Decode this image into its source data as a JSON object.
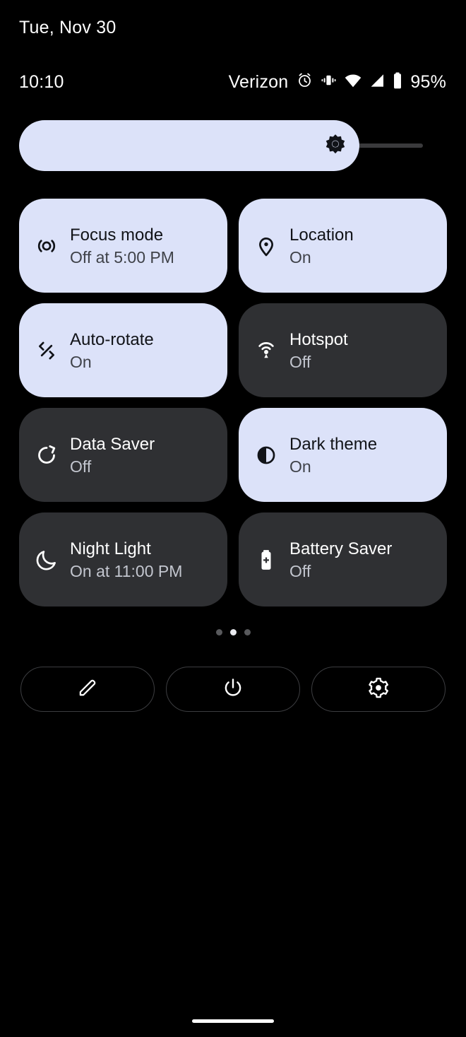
{
  "statusbar": {
    "date": "Tue, Nov 30",
    "clock": "10:10",
    "carrier": "Verizon",
    "battery_percent": "95%",
    "icons": [
      "alarm-icon",
      "vibrate-icon",
      "wifi-icon",
      "cellular-signal-icon",
      "battery-icon"
    ]
  },
  "brightness": {
    "icon": "brightness-icon",
    "level_percent": 84,
    "fill_color": "#dce2f9",
    "track_color": "#3a3a3c"
  },
  "colors": {
    "background": "#000000",
    "tile_active_bg": "#dce2f9",
    "tile_inactive_bg": "#2f3033",
    "tile_active_title": "#111318",
    "tile_active_subtitle": "#3f4249",
    "tile_inactive_title": "#ffffff",
    "tile_inactive_subtitle": "#c3c6cf"
  },
  "tiles": [
    {
      "title": "Focus mode",
      "subtitle": "Off at 5:00 PM",
      "state": "active",
      "icon": "focus-mode-icon"
    },
    {
      "title": "Location",
      "subtitle": "On",
      "state": "active",
      "icon": "location-pin-icon"
    },
    {
      "title": "Auto-rotate",
      "subtitle": "On",
      "state": "active",
      "icon": "auto-rotate-icon"
    },
    {
      "title": "Hotspot",
      "subtitle": "Off",
      "state": "inactive",
      "icon": "hotspot-icon"
    },
    {
      "title": "Data Saver",
      "subtitle": "Off",
      "state": "inactive",
      "icon": "data-saver-icon"
    },
    {
      "title": "Dark theme",
      "subtitle": "On",
      "state": "active",
      "icon": "dark-theme-icon"
    },
    {
      "title": "Night Light",
      "subtitle": "On at 11:00 PM",
      "state": "inactive",
      "icon": "night-light-moon-icon"
    },
    {
      "title": "Battery Saver",
      "subtitle": "Off",
      "state": "inactive",
      "icon": "battery-saver-icon"
    }
  ],
  "pager": {
    "total_pages": 3,
    "current_page": 2
  },
  "bottom_actions": [
    {
      "name": "edit-tiles-button",
      "icon": "pencil-icon"
    },
    {
      "name": "power-button",
      "icon": "power-icon"
    },
    {
      "name": "settings-button",
      "icon": "gear-icon"
    }
  ]
}
